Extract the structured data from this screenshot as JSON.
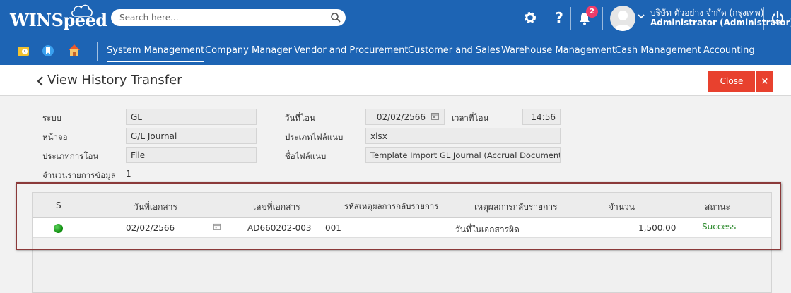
{
  "app": {
    "logo_text": "WINSpeed"
  },
  "header": {
    "search_placeholder": "Search here...",
    "notification_count": "2",
    "company": "บริษัท ตัวอย่าง จำกัด (กรุงเทพ)",
    "user": "Administrator (Administrator)"
  },
  "nav": {
    "items": [
      {
        "label": "System Management"
      },
      {
        "label": "Company Manager"
      },
      {
        "label": "Vendor and Procurement"
      },
      {
        "label": "Customer and Sales"
      },
      {
        "label": "Warehouse Management"
      },
      {
        "label": "Cash Management"
      },
      {
        "label": "Accounting"
      }
    ]
  },
  "page": {
    "title": "View History Transfer",
    "close_label": "Close",
    "x_label": "×"
  },
  "form": {
    "system_label": "ระบบ",
    "system_value": "GL",
    "screen_label": "หน้าจอ",
    "screen_value": "G/L Journal",
    "transfer_type_label": "ประเภทการโอน",
    "transfer_type_value": "File",
    "record_count_label": "จำนวนรายการข้อมูล",
    "record_count_value": "1",
    "transfer_date_label": "วันที่โอน",
    "transfer_date_value": "02/02/2566",
    "transfer_time_label": "เวลาที่โอน",
    "transfer_time_value": "14:56",
    "file_type_label": "ประเภทไฟล์แนบ",
    "file_type_value": "xlsx",
    "file_name_label": "ชื่อไฟล์แนบ",
    "file_name_value": "Template Import GL Journal (Accrual Document) Te"
  },
  "grid": {
    "columns": [
      "S",
      "วันที่เอกสาร",
      "เลขที่เอกสาร",
      "รหัสเหตุผลการกลับรายการ",
      "เหตุผลการกลับรายการ",
      "จำนวน",
      "สถานะ"
    ],
    "rows": [
      {
        "status_color": "#1a9a1a",
        "doc_date": "02/02/2566",
        "doc_no": "AD660202-003",
        "reason_code": "001",
        "reason": "วันที่ในเอกสารผิด",
        "amount": "1,500.00",
        "status": "Success"
      }
    ]
  },
  "colors": {
    "topbar": "#1d64b4",
    "close_button": "#e8412e",
    "success_text": "#2e8b2e",
    "highlight_border": "#8b3a3a"
  }
}
